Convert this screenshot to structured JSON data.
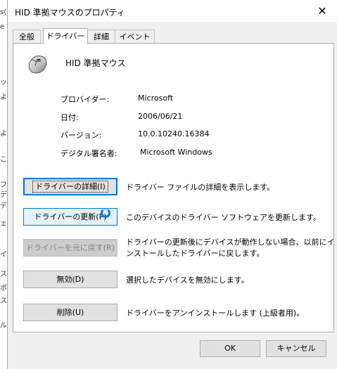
{
  "background_window": {
    "fragments": [
      "s(",
      "e",
      "ッ",
      "よ",
      "よ",
      "こ",
      "フ",
      "デ",
      "デ",
      "ェ",
      "イ",
      "ス",
      "ボ",
      "ス",
      "ル"
    ]
  },
  "window": {
    "title": "HID 準拠マウスのプロパティ",
    "close_glyph": "✕"
  },
  "tabs": [
    {
      "label": "全般"
    },
    {
      "label": "ドライバー"
    },
    {
      "label": "詳細"
    },
    {
      "label": "イベント"
    }
  ],
  "active_tab": "ドライバー",
  "device": {
    "icon": "mouse-icon",
    "name": "HID 準拠マウス"
  },
  "info": [
    {
      "label": "プロバイダー:",
      "value": "Microsoft"
    },
    {
      "label": "日付:",
      "value": "2006/06/21"
    },
    {
      "label": "バージョン:",
      "value": "10.0.10240.16384"
    },
    {
      "label": "デジタル署名者:",
      "value": "Microsoft Windows"
    }
  ],
  "actions": [
    {
      "label": "ドライバーの詳細(I)",
      "description": "ドライバー ファイルの詳細を表示します。",
      "state": "focused"
    },
    {
      "label": "ドライバーの更新(P)",
      "description": "このデバイスのドライバー ソフトウェアを更新します。",
      "state": "hover"
    },
    {
      "label": "ドライバーを元に戻す(R)",
      "description_line1": "ドライバーの更新後にデバイスが動作しない場合、以前にイ",
      "description_line2": "ンストールしたドライバーに戻します。",
      "state": "disabled"
    },
    {
      "label": "無効(D)",
      "description": "選択したデバイスを無効にします。",
      "state": "normal"
    },
    {
      "label": "削除(U)",
      "description": "ドライバーをアンインストールします (上級者用)。",
      "state": "normal"
    }
  ],
  "footer": {
    "ok_label": "OK",
    "cancel_label": "キャンセル"
  },
  "colors": {
    "accent": "#0078d7",
    "dialog_bg": "#f0f0f0",
    "panel_bg": "#ffffff",
    "disabled_text": "#838383"
  },
  "busy_indicator": "loading-spinner-icon"
}
